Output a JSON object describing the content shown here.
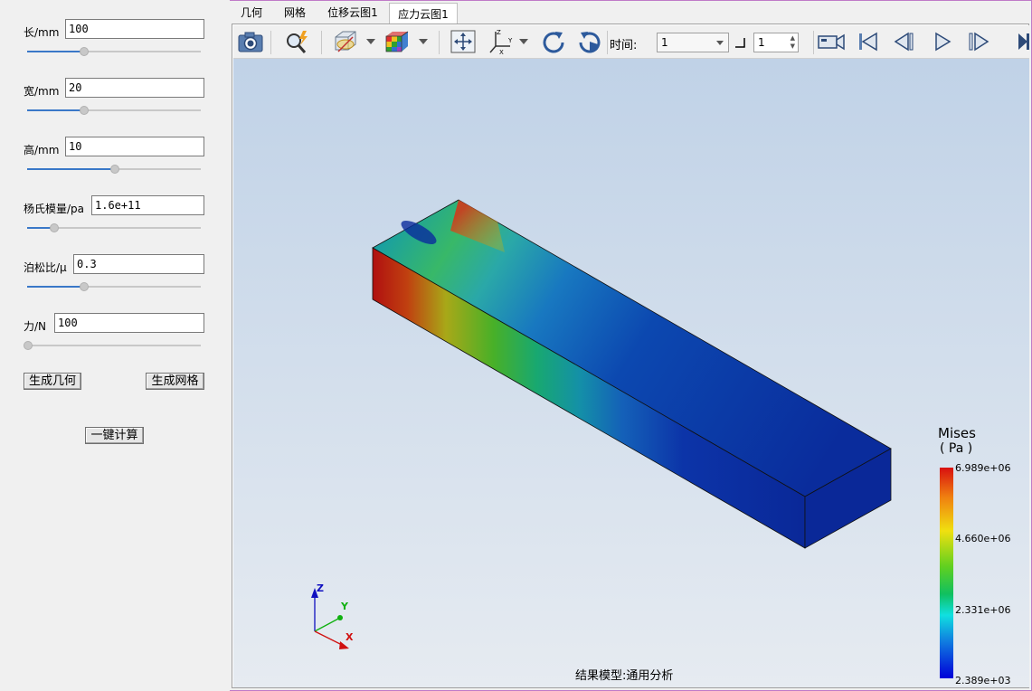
{
  "params": [
    {
      "label": "长/mm",
      "value": "100",
      "slider": 0.33
    },
    {
      "label": "宽/mm",
      "value": "20",
      "slider": 0.33
    },
    {
      "label": "高/mm",
      "value": "10",
      "slider": 0.5
    },
    {
      "label": "杨氏模量/pa",
      "value": "1.6e+11",
      "slider": 0.16
    },
    {
      "label": "泊松比/μ",
      "value": "0.3",
      "slider": 0.33
    },
    {
      "label": "力/N",
      "value": "100",
      "slider": 0.0
    }
  ],
  "buttons": {
    "gen_geometry": "生成几何",
    "gen_mesh": "生成网格",
    "compute": "一键计算"
  },
  "tabs": [
    "几何",
    "网格",
    "位移云图1",
    "应力云图1"
  ],
  "active_tab": 3,
  "toolbar": {
    "time_label": "时间:",
    "time_value": "1",
    "step_value": "1",
    "icons": [
      "camera-icon",
      "probe-icon",
      "clip-plane-icon",
      "colormap-cube-icon",
      "fit-view-icon",
      "axes-icon",
      "rotate-cw-icon",
      "rotate-ccw-icon",
      "video-record-icon",
      "first-frame-icon",
      "prev-frame-icon",
      "play-icon",
      "next-frame-icon"
    ]
  },
  "legend": {
    "title_line1": "Mises",
    "title_line2": "( Pa )",
    "max": "6.989e+06",
    "tick2": "4.660e+06",
    "tick3": "2.331e+06",
    "min": "2.389e+03"
  },
  "axes": {
    "x": "X",
    "y": "Y",
    "z": "Z"
  },
  "footer": "结果模型:通用分析"
}
